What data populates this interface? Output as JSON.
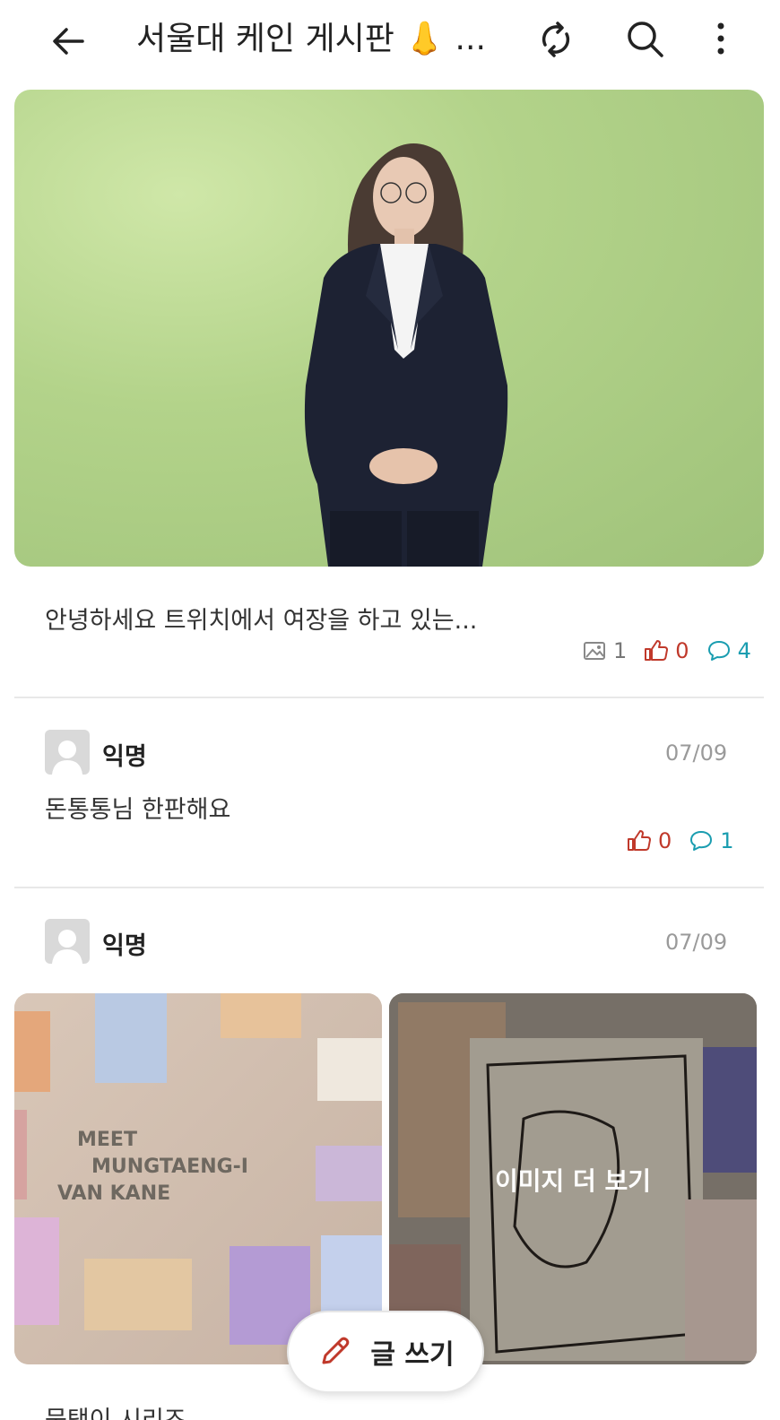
{
  "header": {
    "title": "서울대 케인 게시판 👃 ..."
  },
  "posts": [
    {
      "text": "안녕하세요 트위치에서 여장을 하고 있는...",
      "images": "1",
      "likes": "0",
      "comments": "4"
    },
    {
      "author": "익명",
      "date": "07/09",
      "text": "돈통통님 한판해요",
      "likes": "0",
      "comments": "1"
    },
    {
      "author": "익명",
      "date": "07/09",
      "poster_text": [
        "MEET",
        "MUNGTAENG-I",
        "VAN KANE"
      ],
      "more_images_label": "이미지 더 보기",
      "text_partial": "뭉탱이 시리즈"
    }
  ],
  "fab": {
    "label": "글 쓰기"
  },
  "colors": {
    "like": "#c0392b",
    "comment": "#1a9db0",
    "muted": "#9a9a9a"
  }
}
